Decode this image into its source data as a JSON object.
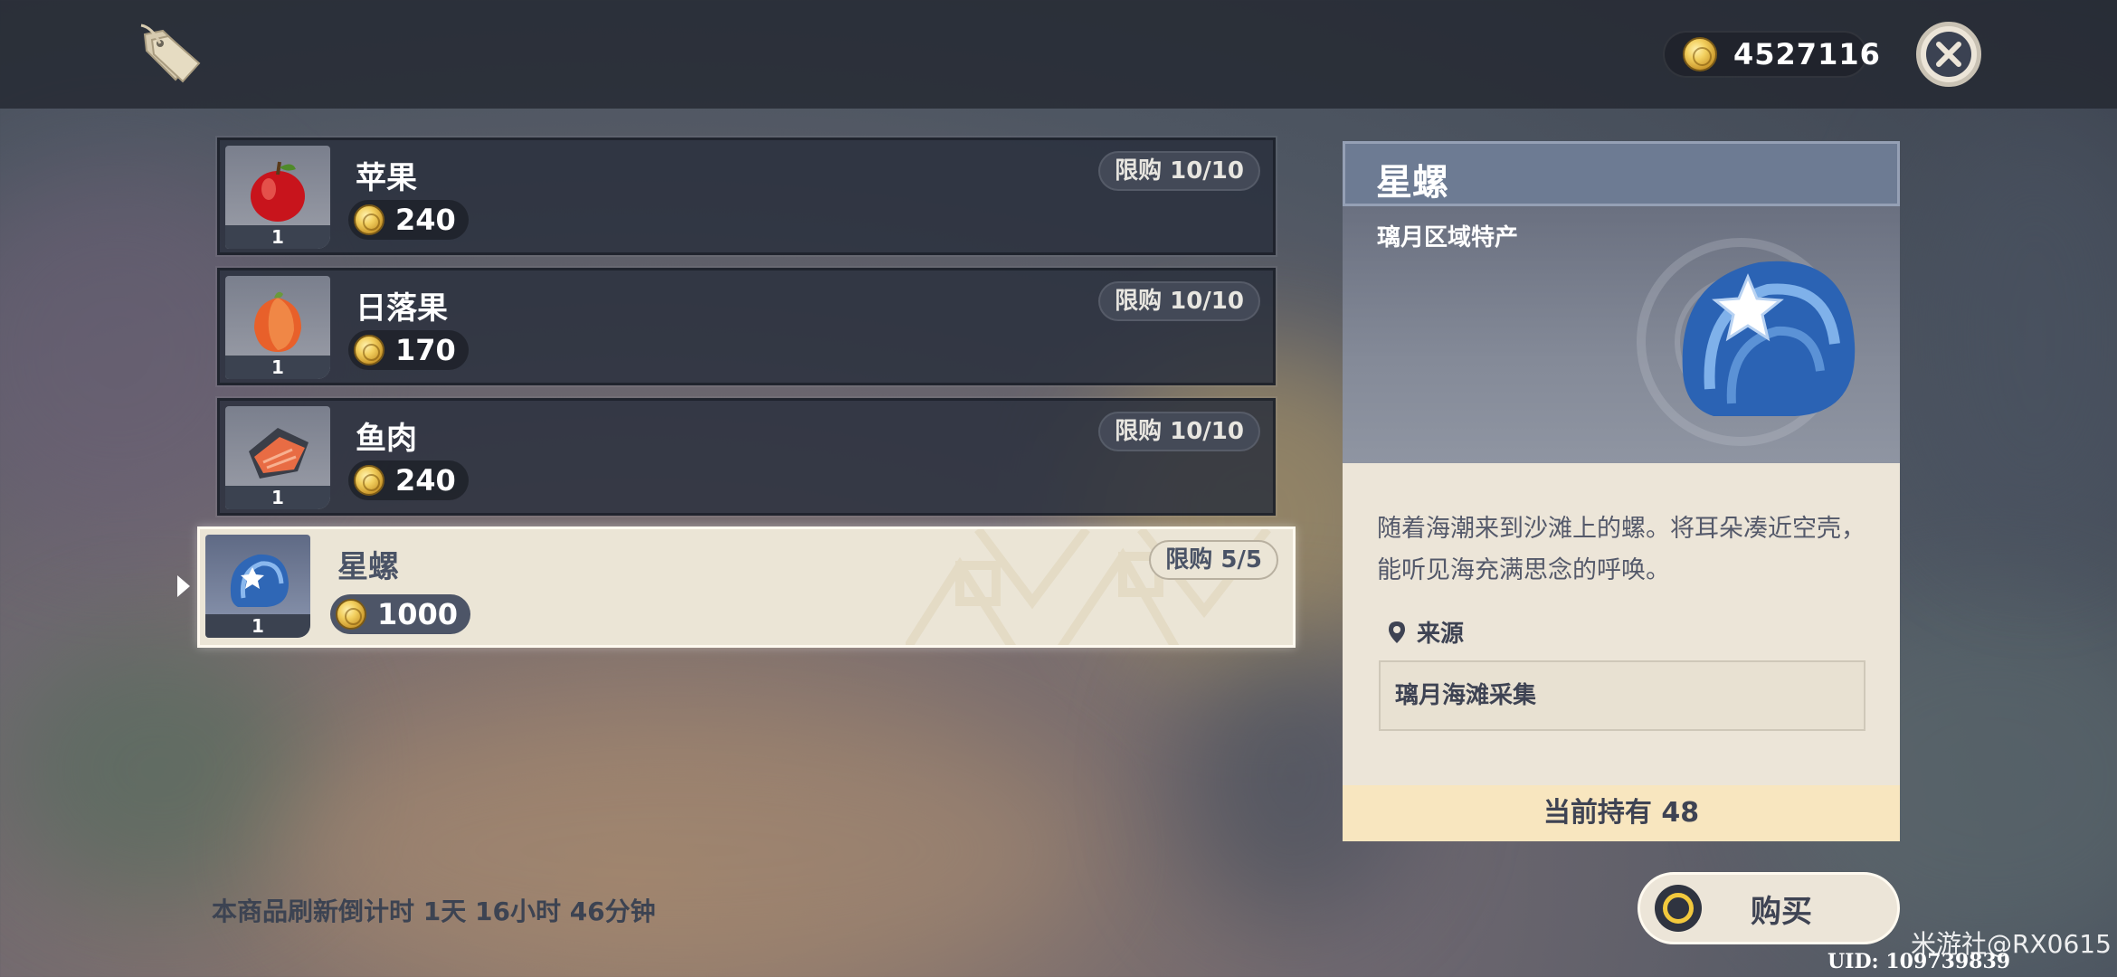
{
  "header": {
    "currency_amount": "4527116",
    "close_icon": "close-icon",
    "tag_icon": "price-tag-icon"
  },
  "items": [
    {
      "name": "苹果",
      "price": "240",
      "limit": "限购 10/10",
      "quantity": "1",
      "icon": "apple-icon"
    },
    {
      "name": "日落果",
      "price": "170",
      "limit": "限购 10/10",
      "quantity": "1",
      "icon": "sunsettia-icon"
    },
    {
      "name": "鱼肉",
      "price": "240",
      "limit": "限购 10/10",
      "quantity": "1",
      "icon": "fish-meat-icon"
    },
    {
      "name": "星螺",
      "price": "1000",
      "limit": "限购 5/5",
      "quantity": "1",
      "icon": "starconch-icon",
      "selected": true
    }
  ],
  "refresh_text": "本商品刷新倒计时 1天 16小时 46分钟",
  "detail": {
    "title": "星螺",
    "subtitle": "璃月区域特产",
    "description": "随着海潮来到沙滩上的螺。将耳朵凑近空壳，能听见海充满思念的呼唤。",
    "source_label": "来源",
    "source_value": "璃月海滩采集",
    "owned": "当前持有 48"
  },
  "buy_label": "购买",
  "watermark": "米游社@RX0615",
  "uid": "UID: 109739839",
  "colors": {
    "panel_cream": "#ece5d8",
    "owned_bg": "#f8e6bf",
    "header_blue": "#6d7b93",
    "coin_gold": "#f2cf5e"
  }
}
